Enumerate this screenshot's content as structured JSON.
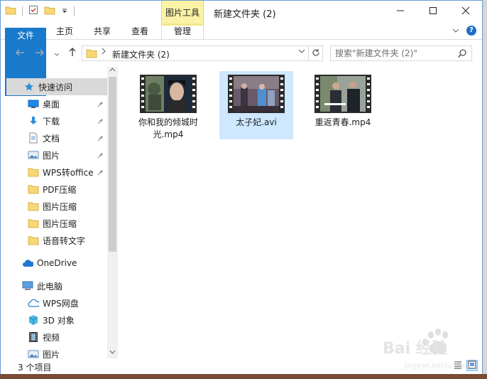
{
  "titlebar": {
    "context_tab": "图片工具",
    "title": "新建文件夹 (2)",
    "controls": [
      "minimize-icon",
      "maximize-icon",
      "close-icon"
    ]
  },
  "ribbon": {
    "tabs": [
      {
        "label": "文件"
      },
      {
        "label": "主页"
      },
      {
        "label": "共享"
      },
      {
        "label": "查看"
      },
      {
        "label": "管理"
      }
    ],
    "help_label": "?"
  },
  "address": {
    "crumb": "新建文件夹 (2)"
  },
  "search": {
    "placeholder": "搜索\"新建文件夹 (2)\""
  },
  "nav": {
    "items": [
      {
        "label": "快速访问",
        "icon": "star-icon"
      },
      {
        "label": "桌面",
        "icon": "desktop-icon"
      },
      {
        "label": "下载",
        "icon": "download-icon"
      },
      {
        "label": "文档",
        "icon": "document-icon"
      },
      {
        "label": "图片",
        "icon": "pictures-icon"
      },
      {
        "label": "WPS转office",
        "icon": "folder-icon"
      },
      {
        "label": "PDF压缩",
        "icon": "folder-icon"
      },
      {
        "label": "图片压缩",
        "icon": "folder-icon"
      },
      {
        "label": "图片压缩",
        "icon": "folder-icon"
      },
      {
        "label": "语音转文字",
        "icon": "folder-icon"
      },
      {
        "label": "OneDrive",
        "icon": "cloud-icon"
      },
      {
        "label": "此电脑",
        "icon": "computer-icon"
      },
      {
        "label": "WPS网盘",
        "icon": "cloud-outline-icon"
      },
      {
        "label": "3D 对象",
        "icon": "cube-icon"
      },
      {
        "label": "视频",
        "icon": "film-icon"
      },
      {
        "label": "图片",
        "icon": "pictures-icon"
      }
    ]
  },
  "files": [
    {
      "name": "你和我的倾城时光.mp4"
    },
    {
      "name": "太子妃.avi"
    },
    {
      "name": "重返青春.mp4"
    }
  ],
  "status": {
    "text": "3 个项目"
  },
  "watermark": {
    "brand": "Bai  经验",
    "url": "jingyan.baidu.com"
  },
  "colors": {
    "accent": "#1979ca",
    "context_tab": "#fbf2a6",
    "selection": "#cde8ff",
    "nav_selected": "#d9d9d9"
  }
}
